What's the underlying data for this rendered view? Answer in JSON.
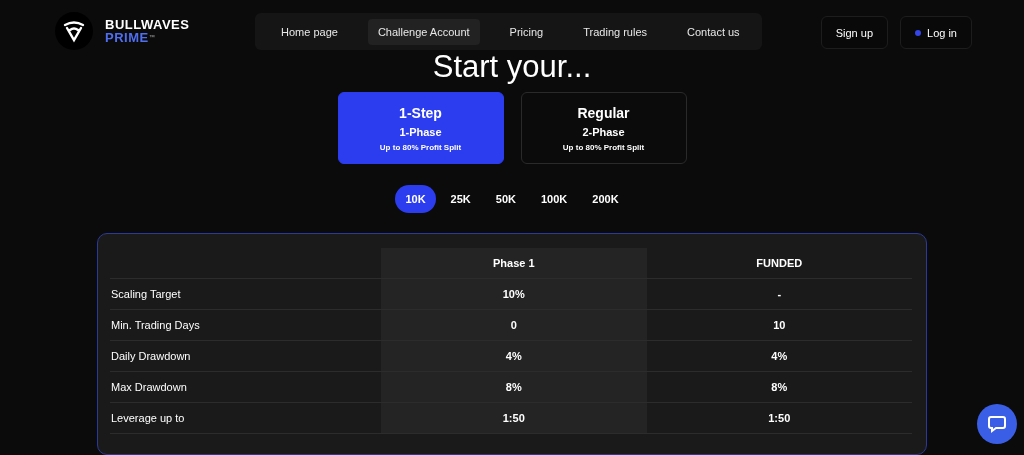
{
  "brand": {
    "name": "BULLWAVES",
    "sub": "PRIME",
    "mark": "™"
  },
  "nav": [
    {
      "label": "Home page",
      "selected": false
    },
    {
      "label": "Challenge Account",
      "selected": true
    },
    {
      "label": "Pricing",
      "selected": false
    },
    {
      "label": "Trading rules",
      "selected": false
    },
    {
      "label": "Contact us",
      "selected": false
    }
  ],
  "auth": {
    "signup": "Sign up",
    "login": "Log in"
  },
  "title": "Start your...",
  "plans": [
    {
      "name": "1-Step",
      "phase": "1-Phase",
      "split": "Up to 80% Profit Split",
      "selected": true
    },
    {
      "name": "Regular",
      "phase": "2-Phase",
      "split": "Up to 80% Profit Split",
      "selected": false
    }
  ],
  "amounts": [
    {
      "label": "10K",
      "selected": true
    },
    {
      "label": "25K",
      "selected": false
    },
    {
      "label": "50K",
      "selected": false
    },
    {
      "label": "100K",
      "selected": false
    },
    {
      "label": "200K",
      "selected": false
    }
  ],
  "table": {
    "columns": [
      "Phase 1",
      "FUNDED"
    ],
    "rows": [
      {
        "label": "Scaling Target",
        "values": [
          "10%",
          "-"
        ]
      },
      {
        "label": "Min. Trading Days",
        "values": [
          "0",
          "10"
        ]
      },
      {
        "label": "Daily Drawdown",
        "values": [
          "4%",
          "4%"
        ]
      },
      {
        "label": "Max Drawdown",
        "values": [
          "8%",
          "8%"
        ]
      },
      {
        "label": "Leverage up to",
        "values": [
          "1:50",
          "1:50"
        ]
      }
    ]
  }
}
